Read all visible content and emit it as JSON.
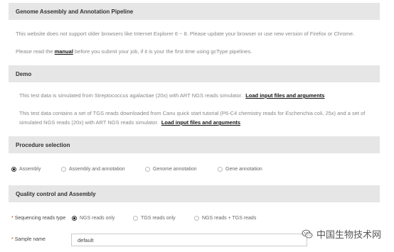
{
  "sections": {
    "pipeline": {
      "title": "Genome Assembly and Annotation Pipeline"
    },
    "demo": {
      "title": "Demo"
    },
    "procedure": {
      "title": "Procedure selection"
    },
    "qc": {
      "title": "Quality control and Assembly"
    }
  },
  "notice": {
    "browser": "This website does not support older browsers like Internet Explorer 6 ~ 8. Please update your browser or use new version of Firefox or Chrome.",
    "manual_prefix": "Please read the",
    "manual_link": "manual",
    "manual_suffix": "before you submit your job, if it is your the first time using gcType pipelines."
  },
  "demo": {
    "item1_text": "This test data is simulated from Streptococcus agalactiae (20x) with ART NGS reads simulator.",
    "item1_link": "Load input files and arguments",
    "item2_line1": "This test data contains a set of TGS reads downloaded from Canu quick start tutorial (P6-C4 chemistry reads for Escherichia coli, 25x) and a set of",
    "item2_line2": "simulated NGS reads (20x) with ART NGS reads simulator.",
    "item2_link": "Load input files and arguments"
  },
  "procedure_options": [
    {
      "label": "Assembly",
      "checked": true
    },
    {
      "label": "Assembly and annotation",
      "checked": false
    },
    {
      "label": "Genome annotation",
      "checked": false
    },
    {
      "label": "Gene annotation",
      "checked": false
    }
  ],
  "qc": {
    "reads_type_label": "Sequencing reads type",
    "reads_options": [
      {
        "label": "NGS reads only",
        "checked": true
      },
      {
        "label": "TGS reads only",
        "checked": false
      },
      {
        "label": "NGS reads + TGS reads",
        "checked": false
      }
    ],
    "sample_name_label": "Sample name",
    "sample_name_value": "default",
    "required_mark": "*"
  },
  "watermark": {
    "text": "中国生物技术网"
  }
}
